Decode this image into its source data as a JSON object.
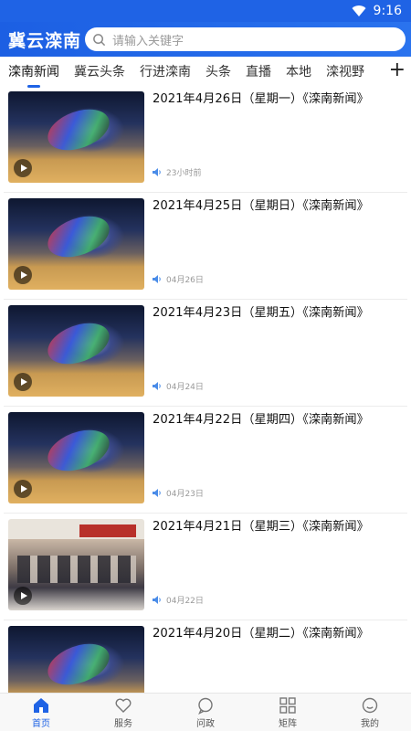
{
  "status": {
    "time": "9:16"
  },
  "header": {
    "brand": "冀云滦南",
    "search_placeholder": "请输入关键字"
  },
  "tabs": [
    "滦南新闻",
    "冀云头条",
    "行进滦南",
    "头条",
    "直播",
    "本地",
    "滦视野"
  ],
  "tab_add": "+",
  "news": [
    {
      "title": "2021年4月26日（星期一）《滦南新闻》",
      "time": "23小时前",
      "thumb": "logo"
    },
    {
      "title": "2021年4月25日（星期日）《滦南新闻》",
      "time": "04月26日",
      "thumb": "logo"
    },
    {
      "title": "2021年4月23日（星期五）《滦南新闻》",
      "time": "04月24日",
      "thumb": "logo"
    },
    {
      "title": "2021年4月22日（星期四）《滦南新闻》",
      "time": "04月23日",
      "thumb": "logo"
    },
    {
      "title": "2021年4月21日（星期三）《滦南新闻》",
      "time": "04月22日",
      "thumb": "meeting"
    },
    {
      "title": "2021年4月20日（星期二）《滦南新闻》",
      "time": "",
      "thumb": "logo"
    }
  ],
  "bottom_nav": [
    {
      "label": "首页",
      "icon": "home-icon"
    },
    {
      "label": "服务",
      "icon": "heart-icon"
    },
    {
      "label": "问政",
      "icon": "chat-icon"
    },
    {
      "label": "矩阵",
      "icon": "grid-icon"
    },
    {
      "label": "我的",
      "icon": "user-icon"
    }
  ],
  "colors": {
    "accent": "#1f63e5"
  }
}
